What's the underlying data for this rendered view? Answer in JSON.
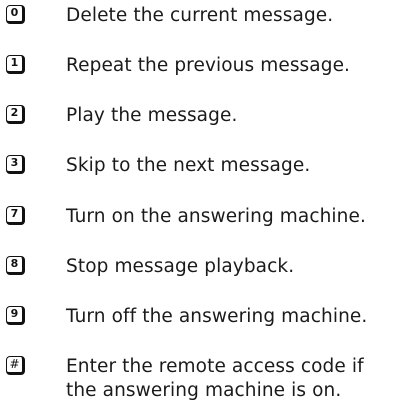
{
  "commands": [
    {
      "key": "0",
      "text": "Delete the current message."
    },
    {
      "key": "1",
      "text": "Repeat the previous message."
    },
    {
      "key": "2",
      "text": "Play the message."
    },
    {
      "key": "3",
      "text": "Skip to the next message."
    },
    {
      "key": "7",
      "text": "Turn on the answering machine."
    },
    {
      "key": "8",
      "text": "Stop message playback."
    },
    {
      "key": "9",
      "text": "Turn off the answering machine."
    },
    {
      "key": "#",
      "text_line1": "Enter the remote access code if",
      "text_line2": "the answering machine is on."
    }
  ]
}
